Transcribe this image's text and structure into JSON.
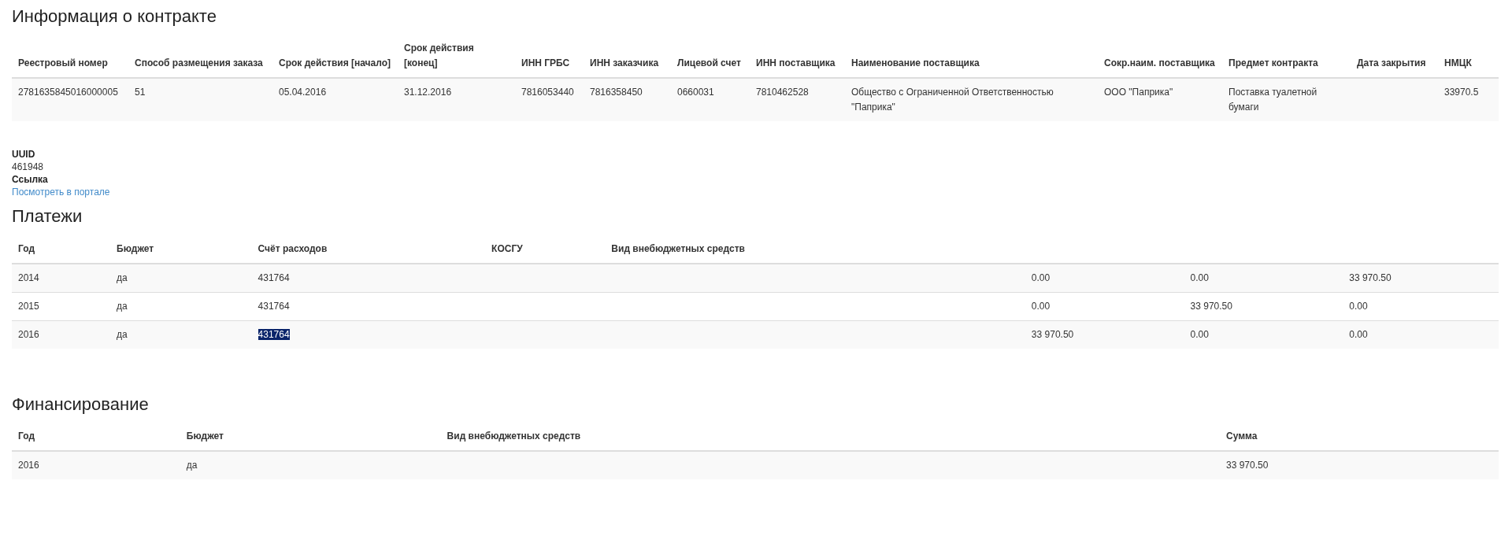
{
  "contract": {
    "title": "Информация о контракте",
    "columns": [
      "Реестровый номер",
      "Способ размещения заказа",
      "Срок действия [начало]",
      "Срок действия [конец]",
      "ИНН ГРБС",
      "ИНН заказчика",
      "Лицевой счет",
      "ИНН поставщика",
      "Наименование поставщика",
      "Сокр.наим. поставщика",
      "Предмет контракта",
      "Дата закрытия",
      "НМЦК"
    ],
    "rows": [
      {
        "cells": [
          "2781635845016000005",
          "51",
          "05.04.2016",
          "31.12.2016",
          "7816053440",
          "7816358450",
          "0660031",
          "7810462528",
          "Общество с Ограниченной Ответственностью \"Паприка\"",
          "ООО \"Паприка\"",
          "Поставка туалетной бумаги",
          null,
          "33970.5"
        ]
      }
    ]
  },
  "details": [
    {
      "label": "UUID",
      "value": "461948",
      "kind": "text"
    },
    {
      "label": "Ссылка",
      "value": "Посмотреть в портале",
      "kind": "link"
    }
  ],
  "payments": {
    "title": "Платежи",
    "columns": [
      "Год",
      "Бюджет",
      "Счёт расходов",
      "КОСГУ",
      "Вид внебюджетных средств"
    ],
    "rows": [
      {
        "year": "2014",
        "budget": "да",
        "account": "431764",
        "highlighted": false,
        "column_6": "0.00",
        "column_7": "0.00",
        "column_8": "33 970.50"
      },
      {
        "year": "2015",
        "budget": "да",
        "account": "431764",
        "highlighted": false,
        "column_6": "0.00",
        "column_7": "33 970.50",
        "column_8": "0.00"
      },
      {
        "year": "2016",
        "budget": "да",
        "account": "431764",
        "highlighted": true,
        "column_6": "33 970.50",
        "column_7": "0.00",
        "column_8": "0.00"
      }
    ]
  },
  "financing": {
    "title": "Финансирование",
    "columns": [
      "Год",
      "Бюджет",
      "Вид внебюджетных средств",
      "Сумма"
    ],
    "rows": [
      {
        "cells": [
          "2016",
          "да",
          null,
          "33 970.50"
        ]
      }
    ]
  }
}
